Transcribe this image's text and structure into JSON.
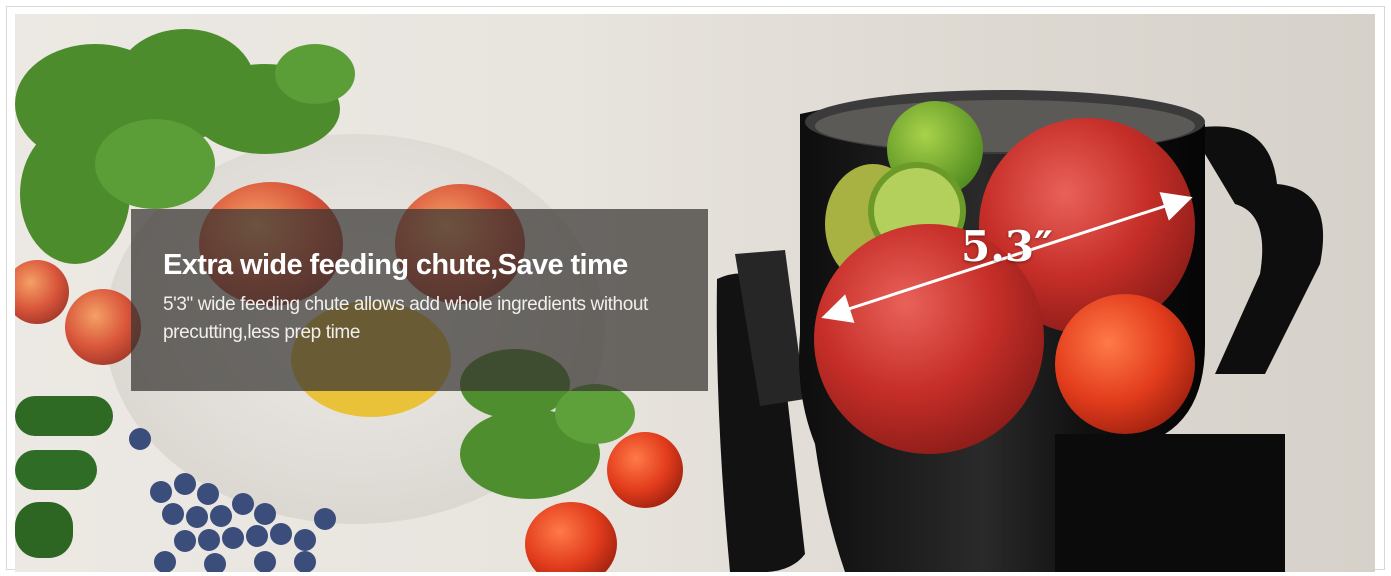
{
  "banner": {
    "headline": "Extra wide feeding chute,Save time",
    "description": "5'3\" wide feeding chute allows add whole ingredients without precutting,less prep time",
    "dimension_label": "5.3″"
  },
  "colors": {
    "overlay": "#3a3634",
    "headline_text": "#ffffff",
    "background": "#e8e4de",
    "juicer_body": "#141414",
    "apple": "#c8322c",
    "tomato": "#e4401c",
    "kale": "#4f8e2e"
  },
  "icons": [
    "double-arrow-icon"
  ]
}
